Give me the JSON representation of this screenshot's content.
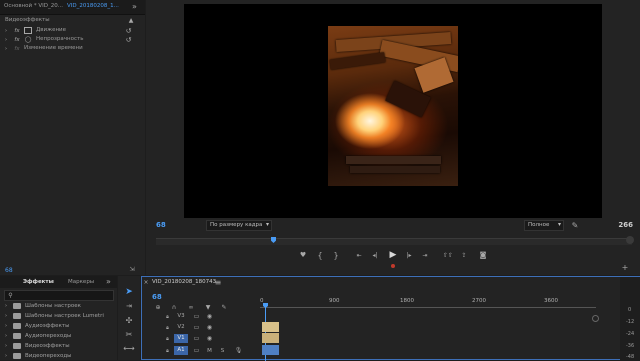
{
  "effect_controls": {
    "tabs": [
      "Основной * VID_20...",
      "VID_20180208_1..."
    ],
    "section": "Видеоэффекты",
    "rows": [
      {
        "label": "Движение"
      },
      {
        "label": "Непрозрачность"
      },
      {
        "label": "Изменение времени"
      }
    ],
    "bottom_timecode": "68"
  },
  "program_monitor": {
    "timecode": "68",
    "fit_value": "По размеру кадра",
    "quality_value": "Полное",
    "duration": "266"
  },
  "effects_browser": {
    "tabs": [
      "Эффекты",
      "Маркеры"
    ],
    "tab_menu": "≡",
    "items": [
      "Шаблоны настроек",
      "Шаблоны настроек Lumetri",
      "Аудиоэффекты",
      "Аудиопереходы",
      "Видеоэффекты",
      "Видеопереходы"
    ]
  },
  "timeline": {
    "sequence_name": "VID_20180208_180743",
    "timecode": "68",
    "ruler_labels": [
      "0",
      "900",
      "1800",
      "2700",
      "3600"
    ],
    "tracks": [
      {
        "name": "V3",
        "selected": false
      },
      {
        "name": "V2",
        "selected": false
      },
      {
        "name": "V1",
        "selected": true
      },
      {
        "name": "A1",
        "selected": true
      }
    ],
    "meter_labels": [
      "0",
      "-12",
      "-24",
      "-36",
      "-48"
    ]
  },
  "colors": {
    "accent_blue": "#4a9cf5",
    "playhead": "#4a9cf5",
    "clip_video": "#d8c18a",
    "clip_audio": "#4f7fc2"
  }
}
